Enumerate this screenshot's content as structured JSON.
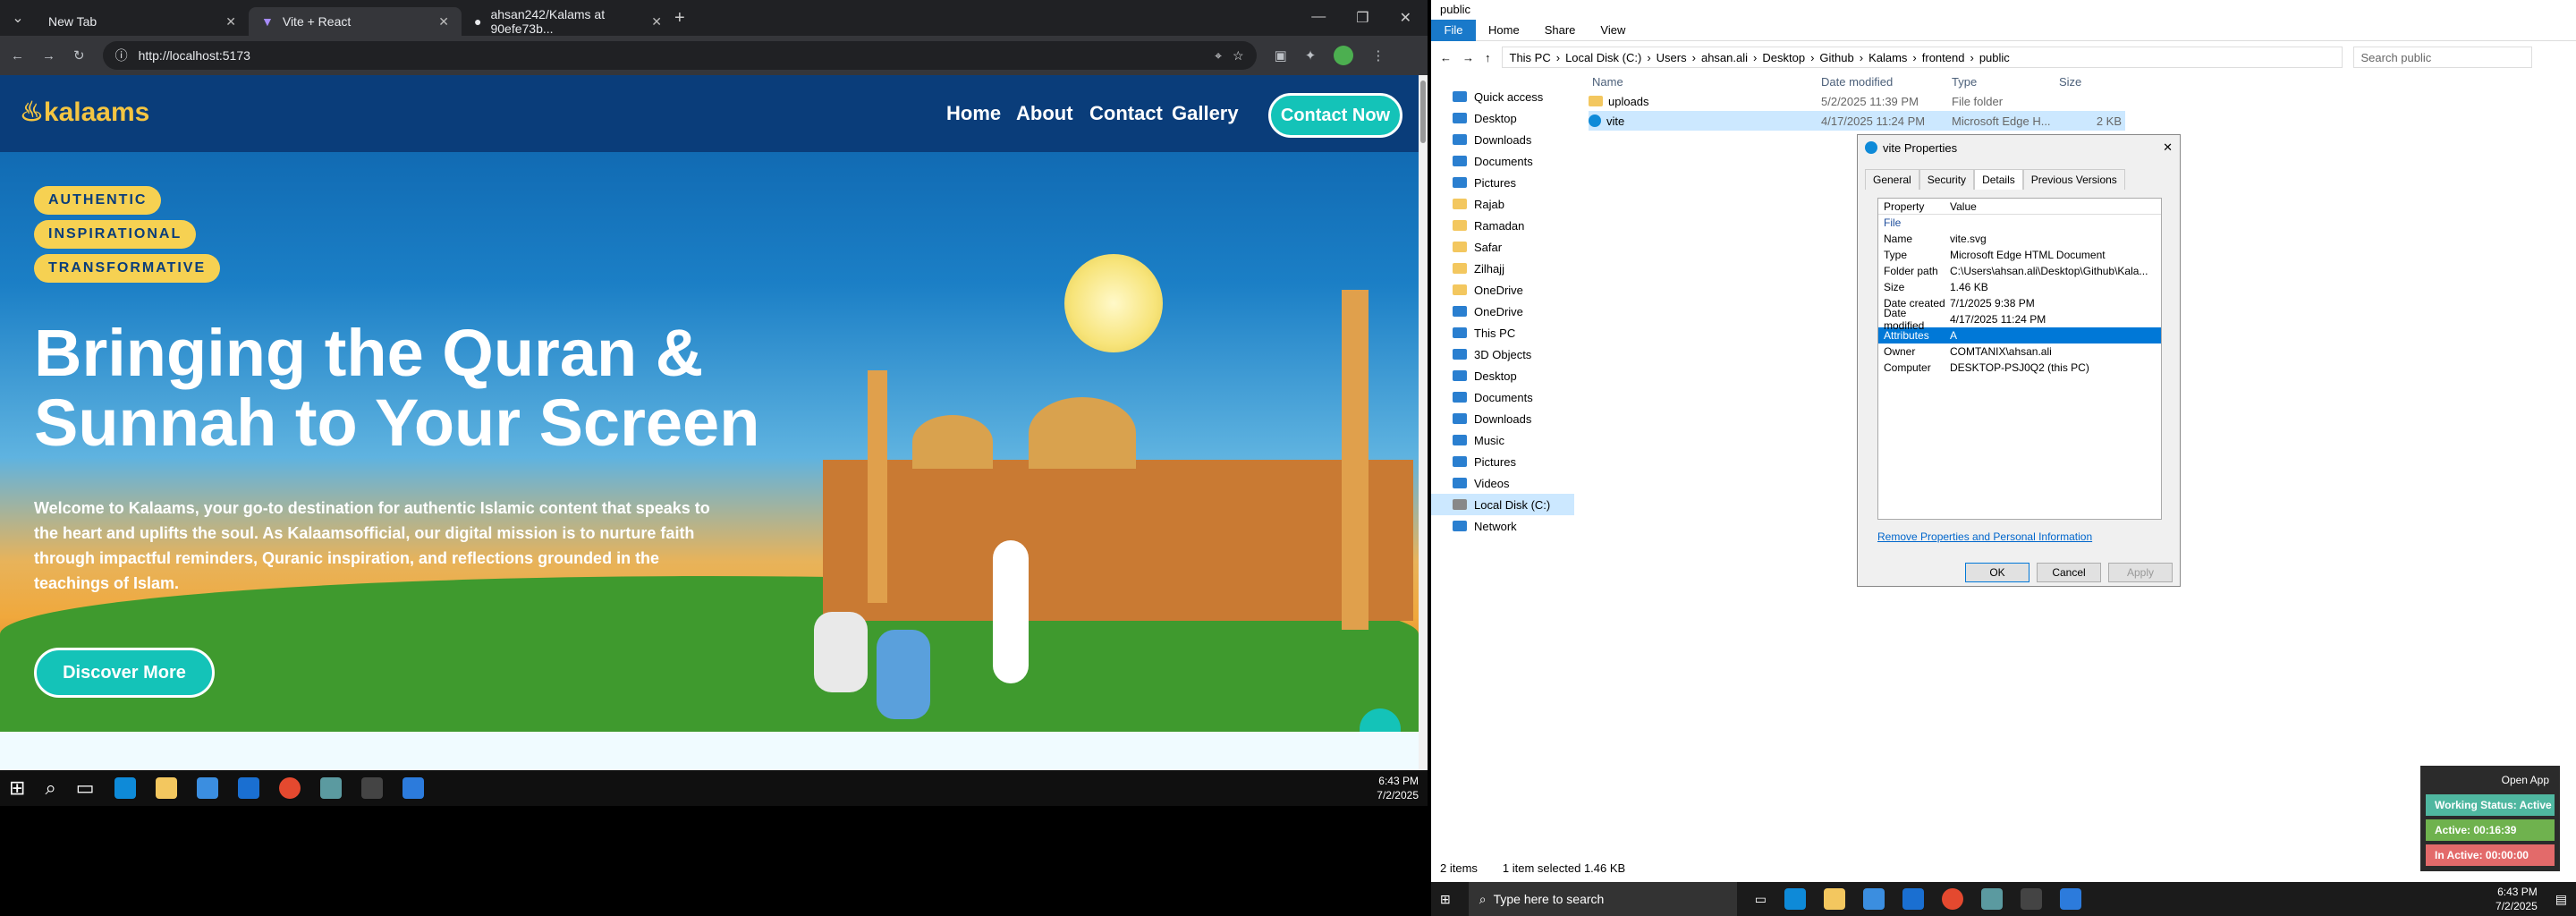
{
  "chrome": {
    "tabs": [
      {
        "label": "New Tab"
      },
      {
        "label": "Vite + React"
      },
      {
        "label": "ahsan242/Kalams at 90efe73b..."
      }
    ],
    "url": "http://localhost:5173"
  },
  "site": {
    "logo": "kalaams",
    "nav": [
      "Home",
      "About",
      "Contact",
      "Gallery"
    ],
    "cta": "Contact Now",
    "badges": [
      "AUTHENTIC",
      "INSPIRATIONAL",
      "TRANSFORMATIVE"
    ],
    "hero_line1": "Bringing the Quran &",
    "hero_line2": "Sunnah to Your Screen",
    "intro": "Welcome to Kalaams, your go-to destination for authentic Islamic content that speaks to the heart and uplifts the soul. As Kalaamsofficial, our digital mission is to nurture faith through impactful reminders, Quranic inspiration, and reflections grounded in the teachings of Islam.",
    "discover": "Discover More"
  },
  "taskbar_left": {
    "time": "6:43 PM",
    "date": "7/2/2025"
  },
  "explorer": {
    "title": "public",
    "ribbon": [
      "File",
      "Home",
      "Share",
      "View"
    ],
    "path": [
      "This PC",
      "Local Disk (C:)",
      "Users",
      "ahsan.ali",
      "Desktop",
      "Github",
      "Kalams",
      "frontend",
      "public"
    ],
    "search_placeholder": "Search public",
    "nav": [
      "Quick access",
      "Desktop",
      "Downloads",
      "Documents",
      "Pictures",
      "Rajab",
      "Ramadan",
      "Safar",
      "Zilhajj",
      "OneDrive",
      "OneDrive",
      "This PC",
      "3D Objects",
      "Desktop",
      "Documents",
      "Downloads",
      "Music",
      "Pictures",
      "Videos",
      "Local Disk (C:)",
      "Network"
    ],
    "columns": [
      "Name",
      "Date modified",
      "Type",
      "Size"
    ],
    "files": [
      {
        "name": "uploads",
        "date": "5/2/2025 11:39 PM",
        "type": "File folder",
        "size": ""
      },
      {
        "name": "vite",
        "date": "4/17/2025 11:24 PM",
        "type": "Microsoft Edge H...",
        "size": "2 KB"
      }
    ],
    "status": {
      "items": "2 items",
      "selected": "1 item selected  1.46 KB"
    }
  },
  "dialog": {
    "title": "vite Properties",
    "tabs": [
      "General",
      "Security",
      "Details",
      "Previous Versions"
    ],
    "header": {
      "k": "Property",
      "v": "Value"
    },
    "section": "File",
    "rows": [
      {
        "k": "Name",
        "v": "vite.svg"
      },
      {
        "k": "Type",
        "v": "Microsoft Edge HTML Document"
      },
      {
        "k": "Folder path",
        "v": "C:\\Users\\ahsan.ali\\Desktop\\Github\\Kala..."
      },
      {
        "k": "Size",
        "v": "1.46 KB"
      },
      {
        "k": "Date created",
        "v": "7/1/2025 9:38 PM"
      },
      {
        "k": "Date modified",
        "v": "4/17/2025 11:24 PM"
      },
      {
        "k": "Attributes",
        "v": "A"
      },
      {
        "k": "Owner",
        "v": "COMTANIX\\ahsan.ali"
      },
      {
        "k": "Computer",
        "v": "DESKTOP-PSJ0Q2 (this PC)"
      }
    ],
    "remove_link": "Remove Properties and Personal Information",
    "ok": "OK",
    "cancel": "Cancel",
    "apply": "Apply"
  },
  "tracker": {
    "open": "Open App",
    "working": "Working Status: Active",
    "active": "Active: 00:16:39",
    "inactive": "In Active: 00:00:00"
  },
  "taskbar_right": {
    "search": "Type here to search",
    "time": "6:43 PM",
    "date": "7/2/2025"
  }
}
